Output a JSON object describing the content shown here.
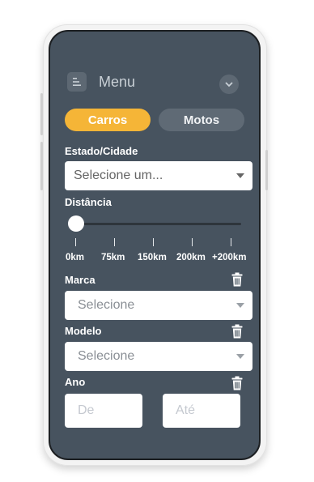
{
  "header": {
    "title": "Menu"
  },
  "tabs": [
    {
      "label": "Carros",
      "active": true
    },
    {
      "label": "Motos",
      "active": false
    }
  ],
  "estado": {
    "label": "Estado/Cidade",
    "placeholder": "Selecione um..."
  },
  "distancia": {
    "label": "Distância",
    "value_fraction": 0,
    "ticks": [
      "0km",
      "75km",
      "150km",
      "200km",
      "+200km"
    ]
  },
  "marca": {
    "label": "Marca",
    "placeholder": "Selecione"
  },
  "modelo": {
    "label": "Modelo",
    "placeholder": "Selecione"
  },
  "ano": {
    "label": "Ano",
    "from_placeholder": "De",
    "to_placeholder": "Até"
  },
  "colors": {
    "accent": "#f5b537",
    "panel": "#47535f",
    "tab_inactive": "#5f6a75"
  },
  "icons": [
    "menu-icon",
    "chevron-down-icon",
    "trash-icon",
    "caret-down-icon"
  ]
}
